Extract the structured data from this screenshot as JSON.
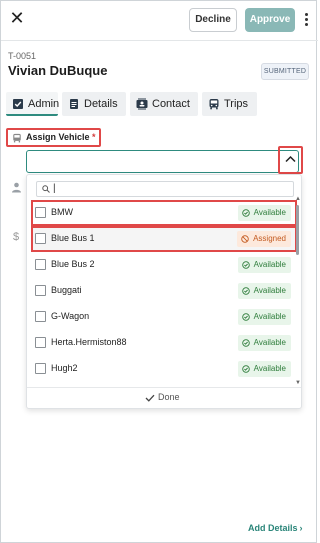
{
  "header": {
    "decline_label": "Decline",
    "approve_label": "Approve",
    "ticket_id": "T-0051",
    "name": "Vivian DuBuque",
    "status": "SUBMITTED"
  },
  "tabs": [
    {
      "label": "Admin",
      "icon": "check-square-icon"
    },
    {
      "label": "Details",
      "icon": "document-icon"
    },
    {
      "label": "Contact",
      "icon": "contact-card-icon"
    },
    {
      "label": "Trips",
      "icon": "bus-icon"
    }
  ],
  "field": {
    "label": "Assign Vehicle",
    "required_mark": "*",
    "value": ""
  },
  "dropdown": {
    "search_value": "",
    "options": [
      {
        "name": "BMW",
        "status": "Available",
        "highlighted": true
      },
      {
        "name": "Blue Bus 1",
        "status": "Assigned",
        "highlighted": true
      },
      {
        "name": "Blue Bus 2",
        "status": "Available"
      },
      {
        "name": "Buggati",
        "status": "Available"
      },
      {
        "name": "G-Wagon",
        "status": "Available"
      },
      {
        "name": "Herta.Hermiston88",
        "status": "Available"
      },
      {
        "name": "Hugh2",
        "status": "Available"
      }
    ],
    "done_label": "Done"
  },
  "footer": {
    "add_details_label": "Add Details"
  },
  "colors": {
    "accent": "#2e8b7f",
    "highlight_outline": "#e04848",
    "available_bg": "#e8f5ea",
    "available_text": "#2f7d3c",
    "assigned_bg": "#fde9dc",
    "assigned_text": "#c35a1f"
  }
}
